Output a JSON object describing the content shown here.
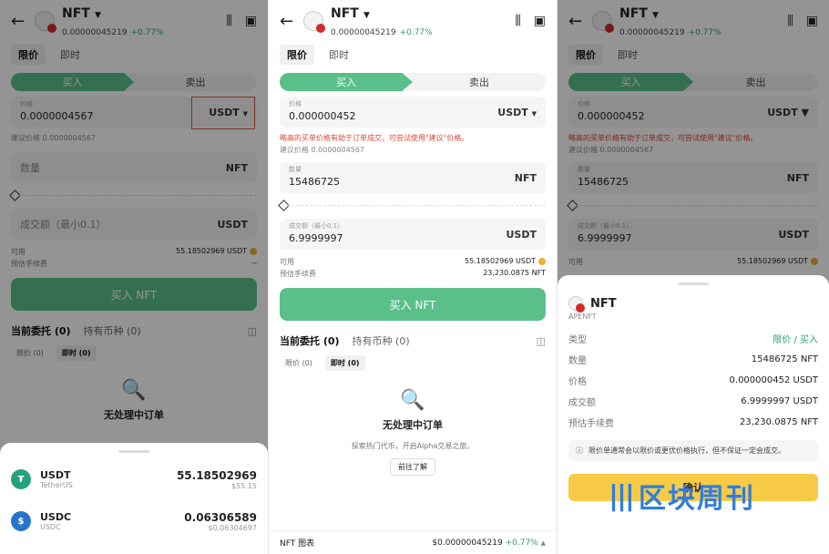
{
  "token": {
    "name": "NFT",
    "price": "0.00000045219",
    "change": "+0.77%"
  },
  "order_tabs": [
    "限价",
    "即时"
  ],
  "side": {
    "buy": "买入",
    "sell": "卖出"
  },
  "panel1": {
    "price_label": "价格",
    "price_value": "0.0000004567",
    "price_unit": "USDT",
    "suggest": "建议价格 0.0000004567",
    "qty_placeholder": "数量",
    "qty_unit": "NFT",
    "amt_placeholder": "成交额（最小0.1）",
    "amt_unit": "USDT",
    "avail_label": "可用",
    "avail_value": "55.18502969 USDT",
    "fee_label": "预估手续费",
    "fee_value": "--",
    "buy_btn": "买入 NFT",
    "tab_current": "当前委托 (0)",
    "tab_holdings": "持有币种 (0)",
    "sub_limit": "限价 (0)",
    "sub_instant": "即时 (0)",
    "empty": "无处理中订单",
    "assets": [
      {
        "symbol": "USDT",
        "name": "TetherUS",
        "balance": "55.18502969",
        "usd": "$55.15",
        "color": "#26a17b",
        "glyph": "₮"
      },
      {
        "symbol": "USDC",
        "name": "USDC",
        "balance": "0.06306589",
        "usd": "$0.06304697",
        "color": "#2775ca",
        "glyph": "$"
      }
    ]
  },
  "panel2": {
    "price_label": "价格",
    "price_value": "0.000000452",
    "price_unit": "USDT",
    "warning": "略高的买单价格有助于订单成交，可尝试使用\"建议\"价格。",
    "suggest": "建议价格 0.0000004567",
    "qty_label": "数量",
    "qty_value": "15486725",
    "qty_unit": "NFT",
    "amt_label": "成交额（最小0.1）",
    "amt_value": "6.9999997",
    "amt_unit": "USDT",
    "avail_label": "可用",
    "avail_value": "55.18502969 USDT",
    "fee_label": "预估手续费",
    "fee_value": "23,230.0875 NFT",
    "buy_btn": "买入 NFT",
    "tab_current": "当前委托 (0)",
    "tab_holdings": "持有币种 (0)",
    "sub_limit": "限价 (0)",
    "sub_instant": "即时 (0)",
    "empty_title": "无处理中订单",
    "empty_desc": "探索热门代币，开启Alpha交易之旅。",
    "empty_btn": "前往了解",
    "footer_label": "NFT 图表",
    "footer_price": "$0.00000045219",
    "footer_change": "+0.77%"
  },
  "panel3": {
    "confirm_token": "NFT",
    "confirm_sub": "APENFT",
    "rows": [
      {
        "k": "类型",
        "v": "限价 / 买入",
        "green": true
      },
      {
        "k": "数量",
        "v": "15486725 NFT",
        "green": false
      },
      {
        "k": "价格",
        "v": "0.000000452 USDT",
        "green": false
      },
      {
        "k": "成交额",
        "v": "6.9999997 USDT",
        "green": false
      },
      {
        "k": "预估手续费",
        "v": "23,230.0875 NFT",
        "green": false
      }
    ],
    "note": "限价单通常会以限价或更优价格执行，但不保证一定会成交。",
    "confirm_btn": "确认",
    "bg_price": "0.000000452",
    "bg_qty": "15486725",
    "bg_amt": "6.9999997",
    "bg_avail": "55.18502969 USDT"
  },
  "watermark": {
    "logo": "|||",
    "text": "区块周刊"
  }
}
